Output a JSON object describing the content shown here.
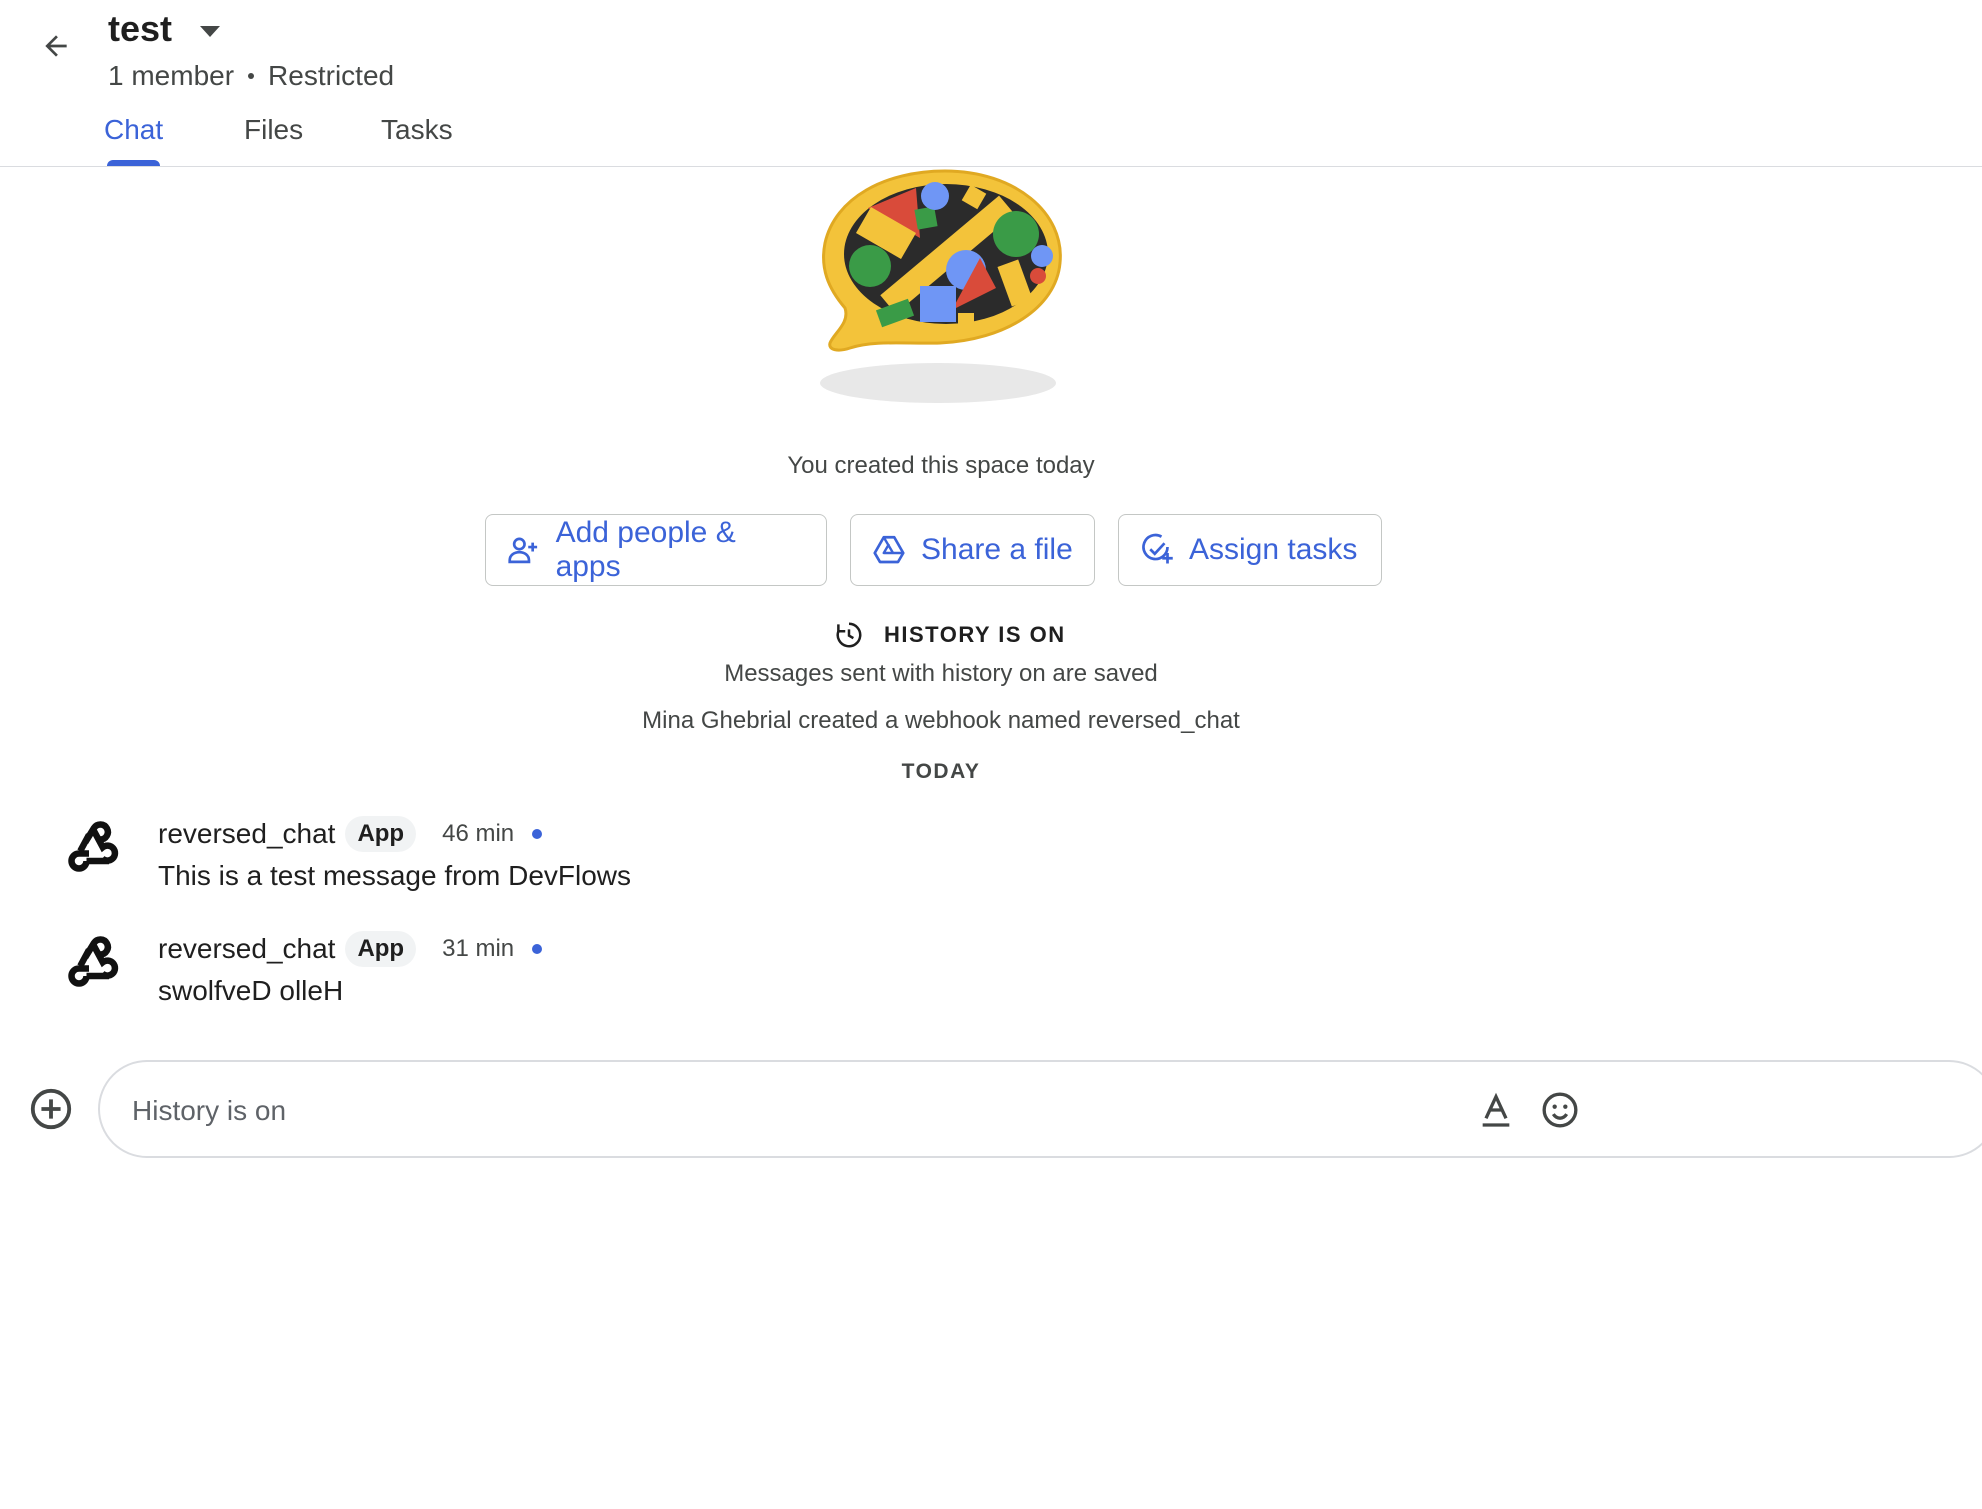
{
  "header": {
    "back_icon": "arrow-left-icon",
    "title": "test",
    "dropdown_icon": "caret-down-icon",
    "members": "1 member",
    "access": "Restricted"
  },
  "tabs": [
    {
      "label": "Chat",
      "active": true
    },
    {
      "label": "Files",
      "active": false
    },
    {
      "label": "Tasks",
      "active": false
    }
  ],
  "intro": {
    "created_text": "You created this space today",
    "actions": [
      {
        "label": "Add people & apps",
        "icon": "person-add-icon"
      },
      {
        "label": "Share a file",
        "icon": "drive-icon"
      },
      {
        "label": "Assign tasks",
        "icon": "task-add-icon"
      }
    ],
    "history_title": "HISTORY IS ON",
    "history_icon": "history-icon",
    "history_subtitle": "Messages sent with history on are saved",
    "webhook_note": "Mina Ghebrial created a webhook named reversed_chat",
    "date_divider": "TODAY"
  },
  "messages": [
    {
      "sender": "reversed_chat",
      "badge": "App",
      "time": "46 min",
      "text": "This is a test message from DevFlows",
      "avatar_icon": "webhook-icon"
    },
    {
      "sender": "reversed_chat",
      "badge": "App",
      "time": "31 min",
      "text": "swolfveD olleH",
      "avatar_icon": "webhook-icon"
    }
  ],
  "composer": {
    "placeholder": "History is on",
    "add_icon": "plus-circle-icon",
    "format_icon": "text-format-icon",
    "emoji_icon": "emoji-icon"
  },
  "colors": {
    "accent": "#3b63d8",
    "text": "#1f1f1f",
    "muted": "#444746",
    "border": "#dadce0"
  }
}
